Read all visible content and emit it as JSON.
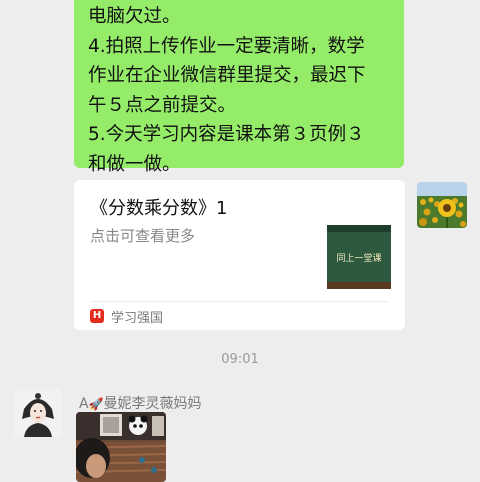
{
  "message_text": {
    "line1": "电脑欠过。",
    "line2": "4.拍照上传作业一定要清晰，数学",
    "line3": "作业在企业微信群里提交，最迟下",
    "line4": "午５点之前提交。",
    "line5": "5.今天学习内容是课本第３页例３",
    "line6": "和做一做。"
  },
  "share_card": {
    "title": "《分数乘分数》1",
    "description": "点击可查看更多",
    "thumbnail_text": "同上一堂课",
    "source_logo_char": "H",
    "source_name": "学习强国",
    "logo_color": "#e42b1c"
  },
  "timestamp": "09:01",
  "sender": {
    "prefix": "A",
    "name": "曼妮李灵薇妈妈"
  },
  "colors": {
    "background": "#ededed",
    "sent_bubble": "#95ec69",
    "card": "#ffffff"
  }
}
